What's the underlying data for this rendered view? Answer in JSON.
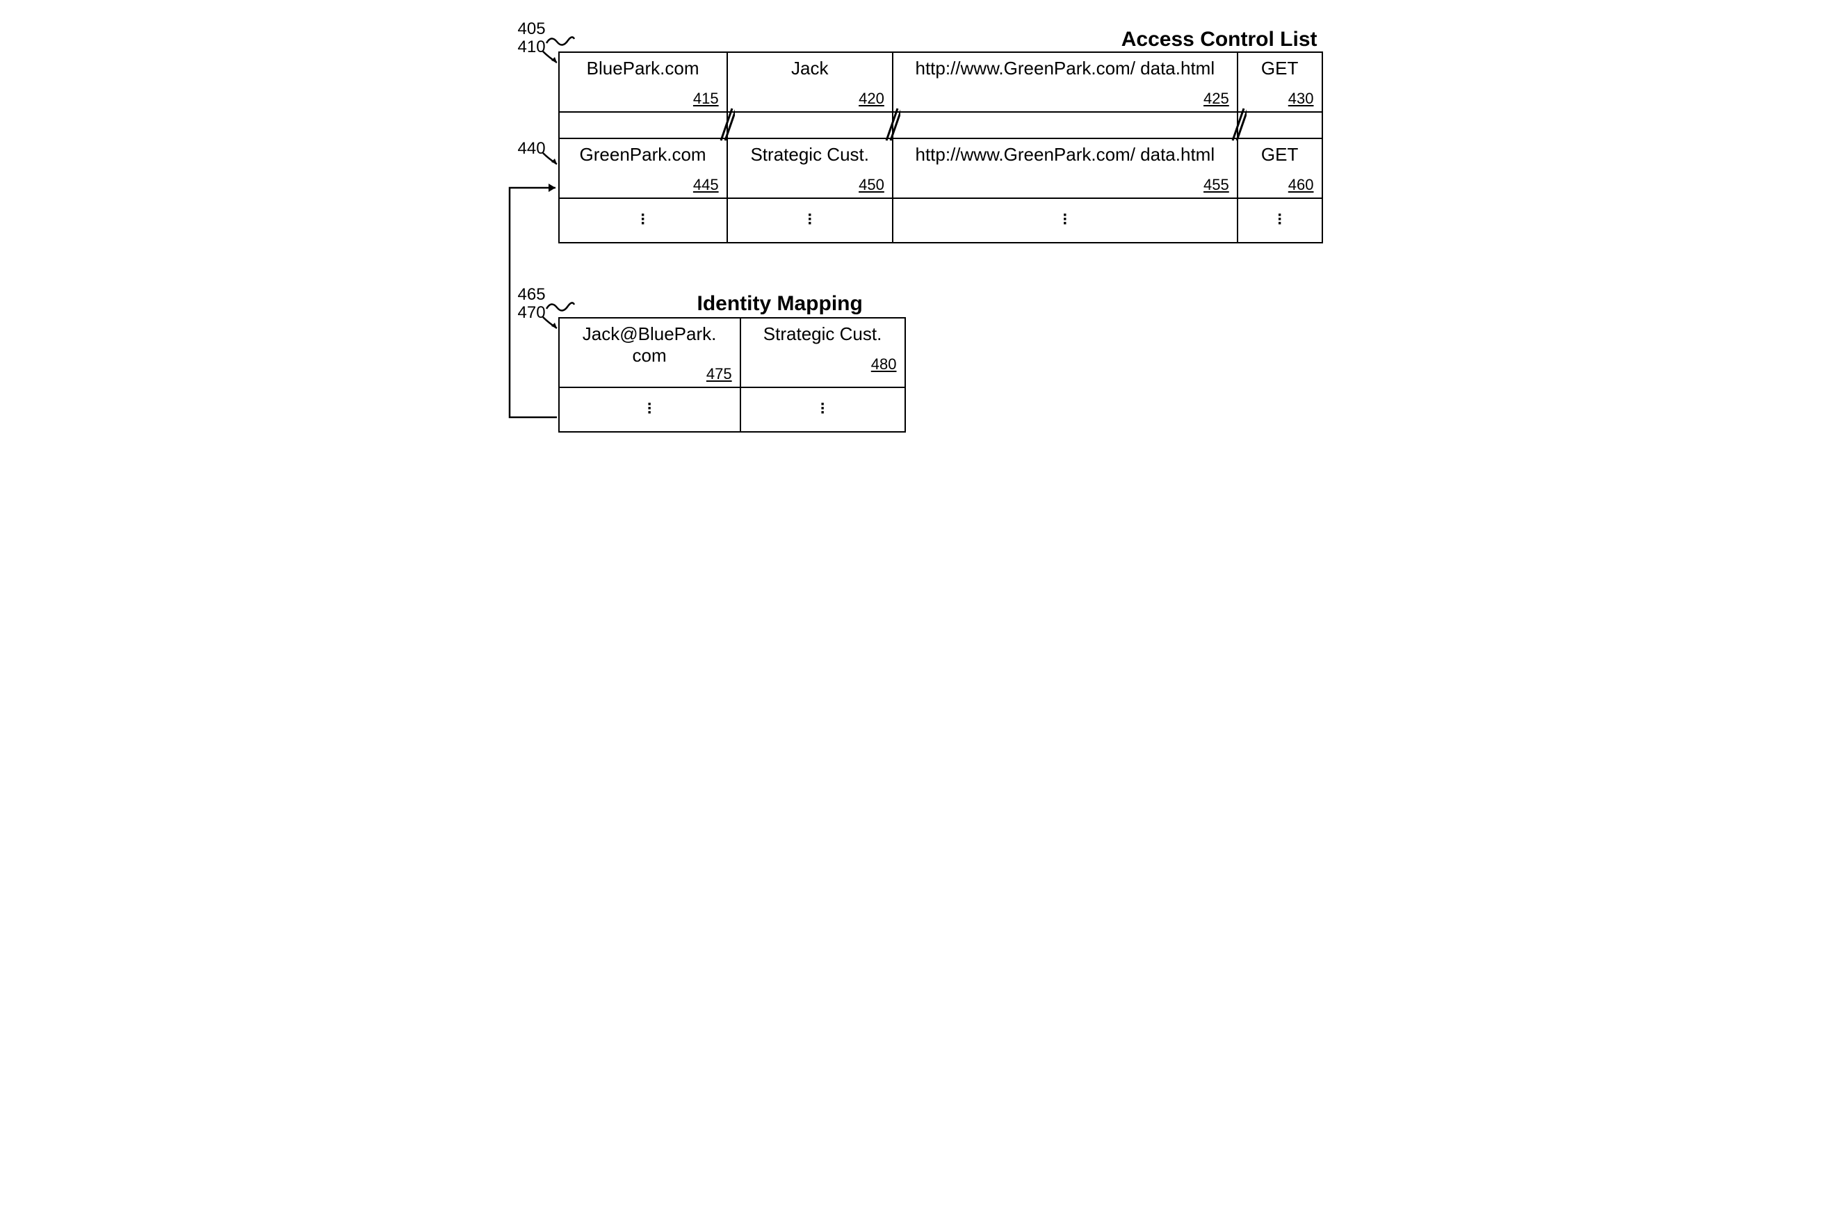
{
  "acl": {
    "title": "Access Control List",
    "ref_outer_top": "405",
    "ref_row1": "410",
    "ref_row2": "440",
    "rows": [
      {
        "domain": "BluePark.com",
        "domain_ref": "415",
        "principal": "Jack",
        "principal_ref": "420",
        "resource": "http://www.GreenPark.com/ data.html",
        "resource_ref": "425",
        "action": "GET",
        "action_ref": "430"
      },
      {
        "domain": "GreenPark.com",
        "domain_ref": "445",
        "principal": "Strategic Cust.",
        "principal_ref": "450",
        "resource": "http://www.GreenPark.com/ data.html",
        "resource_ref": "455",
        "action": "GET",
        "action_ref": "460"
      }
    ]
  },
  "identity_mapping": {
    "title": "Identity Mapping",
    "ref_outer_top": "465",
    "ref_row1": "470",
    "rows": [
      {
        "identity": "Jack@BluePark. com",
        "identity_ref": "475",
        "maps_to": "Strategic Cust.",
        "maps_to_ref": "480"
      }
    ]
  }
}
